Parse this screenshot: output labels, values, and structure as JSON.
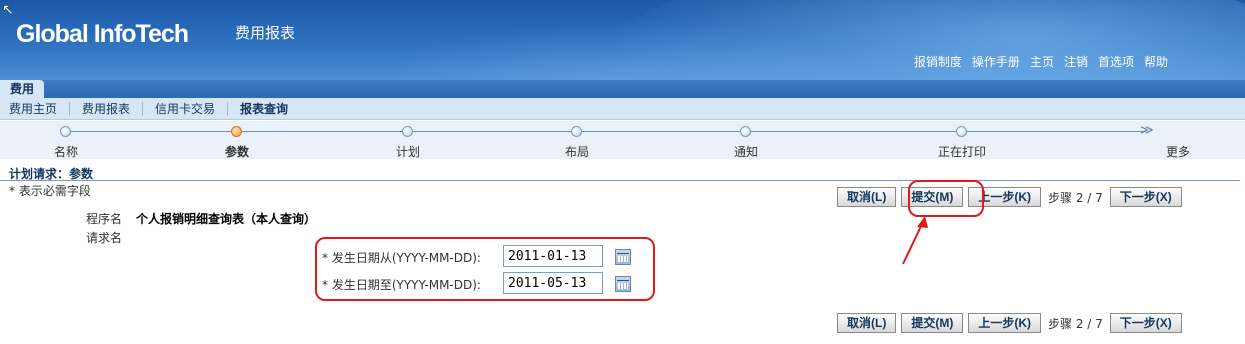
{
  "header": {
    "logo": "Global InfoTech",
    "app_title": "费用报表",
    "links": [
      "报销制度",
      "操作手册",
      "主页",
      "注销",
      "首选项",
      "帮助"
    ]
  },
  "tab": {
    "label": "费用"
  },
  "subnav": {
    "items": [
      "费用主页",
      "费用报表",
      "信用卡交易",
      "报表查询"
    ],
    "active": "报表查询"
  },
  "train": {
    "steps": [
      "名称",
      "参数",
      "计划",
      "布局",
      "通知",
      "正在打印",
      "更多"
    ],
    "current": "参数"
  },
  "page": {
    "title": "计划请求：参数",
    "required_note": "* 表示必需字段"
  },
  "buttons": {
    "cancel": "取消(L)",
    "submit": "提交(M)",
    "back": "上一步(K)",
    "step_text": "步骤 2 / 7",
    "next": "下一步(X)"
  },
  "form": {
    "program_label": "程序名",
    "program_value": "个人报销明细查询表（本人查询）",
    "request_label": "请求名",
    "date_from_label": "* 发生日期从(YYYY-MM-DD):",
    "date_from_value": "2011-01-13",
    "date_to_label": "* 发生日期至(YYYY-MM-DD):",
    "date_to_value": "2011-05-13"
  },
  "colors": {
    "annotation": "#e01a1a",
    "header_blue": "#2e72c0",
    "link_blue": "#12365f"
  }
}
